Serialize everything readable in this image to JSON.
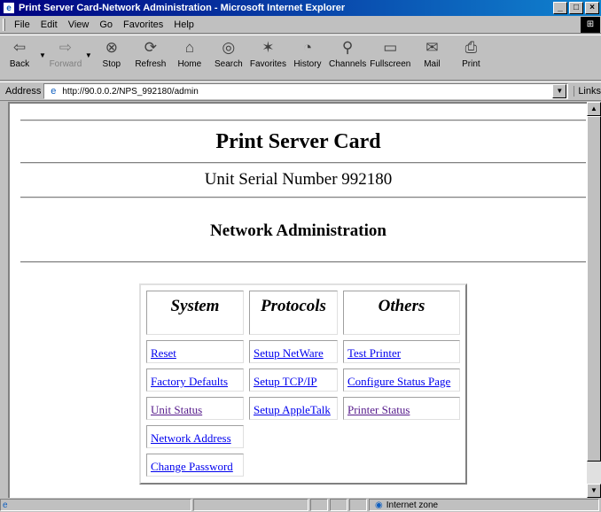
{
  "window": {
    "title": "Print Server Card-Network Administration - Microsoft Internet Explorer",
    "controls": [
      "_",
      "□",
      "×"
    ]
  },
  "menu": [
    "File",
    "Edit",
    "View",
    "Go",
    "Favorites",
    "Help"
  ],
  "toolbar": [
    {
      "label": "Back",
      "icon": "back-arrow-icon",
      "glyph": "⇦",
      "dropdown": true,
      "enabled": true
    },
    {
      "label": "Forward",
      "icon": "forward-arrow-icon",
      "glyph": "⇨",
      "dropdown": true,
      "enabled": false
    },
    {
      "label": "Stop",
      "icon": "stop-icon",
      "glyph": "⊗",
      "enabled": true
    },
    {
      "label": "Refresh",
      "icon": "refresh-icon",
      "glyph": "⟳",
      "enabled": true
    },
    {
      "label": "Home",
      "icon": "home-icon",
      "glyph": "⌂",
      "enabled": true
    },
    {
      "label": "Search",
      "icon": "search-icon",
      "glyph": "◎",
      "enabled": true
    },
    {
      "label": "Favorites",
      "icon": "favorites-icon",
      "glyph": "✶",
      "enabled": true
    },
    {
      "label": "History",
      "icon": "history-icon",
      "glyph": "◔",
      "enabled": true
    },
    {
      "label": "Channels",
      "icon": "channels-icon",
      "glyph": "⚲",
      "enabled": true
    },
    {
      "label": "Fullscreen",
      "icon": "fullscreen-icon",
      "glyph": "▭",
      "enabled": true
    },
    {
      "label": "Mail",
      "icon": "mail-icon",
      "glyph": "✉",
      "enabled": true
    },
    {
      "label": "Print",
      "icon": "print-icon",
      "glyph": "⎙",
      "enabled": true
    }
  ],
  "address": {
    "label": "Address",
    "url": "http://90.0.0.2/NPS_992180/admin",
    "links_label": "Links"
  },
  "page": {
    "title": "Print Server Card",
    "serial": "Unit Serial Number 992180",
    "section": "Network Administration"
  },
  "admin": {
    "headers": [
      "System",
      "Protocols",
      "Others"
    ],
    "system": [
      "Reset",
      "Factory Defaults",
      "Unit Status",
      "Network Address",
      "Change Password"
    ],
    "protocols": [
      "Setup NetWare",
      "Setup TCP/IP",
      "Setup AppleTalk"
    ],
    "others": [
      "Test Printer",
      "Configure Status Page",
      "Printer Status"
    ]
  },
  "status": {
    "zone": "Internet zone"
  }
}
